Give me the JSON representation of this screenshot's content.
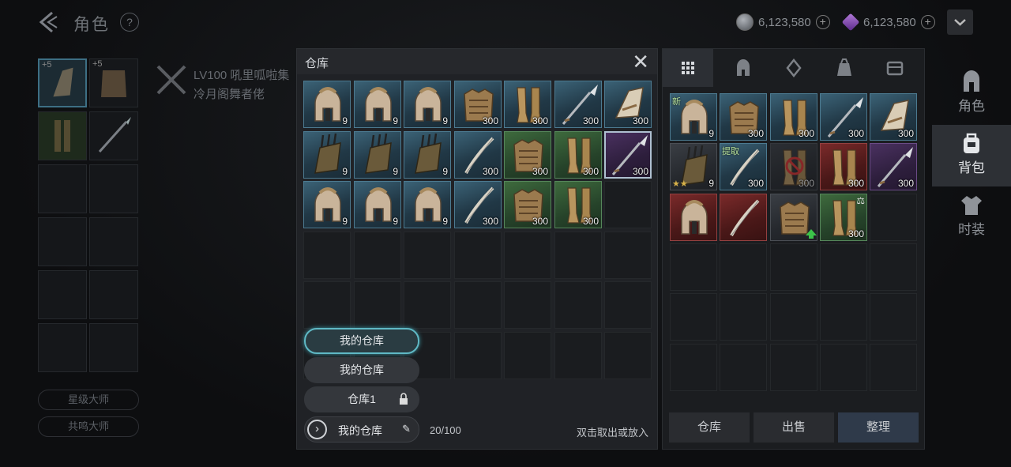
{
  "header": {
    "back_icon": "back-chevron-icon",
    "title": "角色",
    "help": "?",
    "currency": [
      {
        "icon": "silver-coin-icon",
        "amount": "6,123,580"
      },
      {
        "icon": "purple-gem-icon",
        "amount": "6,123,580"
      }
    ],
    "dropdown_icon": "chevron-down-icon"
  },
  "character": {
    "level_line": "LV100  吼里呱啦集",
    "title": "冷月阁舞者佬",
    "equip_plus": [
      "+5",
      "+5"
    ],
    "buttons": [
      "星级大师",
      "共鸣大师"
    ]
  },
  "warehouse": {
    "title": "仓库",
    "close": "✕",
    "items": [
      {
        "type": "helmet",
        "rarity": "blue",
        "qty": "9"
      },
      {
        "type": "helmet",
        "rarity": "blue",
        "qty": "9"
      },
      {
        "type": "helmet",
        "rarity": "blue",
        "qty": "9"
      },
      {
        "type": "armor",
        "rarity": "blue",
        "qty": "300"
      },
      {
        "type": "greaves",
        "rarity": "blue",
        "qty": "300"
      },
      {
        "type": "spear",
        "rarity": "blue",
        "qty": "300"
      },
      {
        "type": "bracer",
        "rarity": "blue",
        "qty": "300"
      },
      {
        "type": "quiver",
        "rarity": "blue",
        "qty": "9"
      },
      {
        "type": "quiver",
        "rarity": "blue",
        "qty": "9"
      },
      {
        "type": "quiver",
        "rarity": "blue",
        "qty": "9"
      },
      {
        "type": "bow",
        "rarity": "blue",
        "qty": "300"
      },
      {
        "type": "armor",
        "rarity": "green",
        "qty": "300"
      },
      {
        "type": "greaves",
        "rarity": "green",
        "qty": "300"
      },
      {
        "type": "spear",
        "rarity": "purple",
        "qty": "300",
        "selected": true
      },
      {
        "type": "helmet",
        "rarity": "blue",
        "qty": "9"
      },
      {
        "type": "helmet",
        "rarity": "blue",
        "qty": "9"
      },
      {
        "type": "helmet",
        "rarity": "blue",
        "qty": "9"
      },
      {
        "type": "bow",
        "rarity": "blue",
        "qty": "300"
      },
      {
        "type": "armor",
        "rarity": "green",
        "qty": "300"
      },
      {
        "type": "greaves",
        "rarity": "green",
        "qty": "300"
      }
    ],
    "options": [
      "我的仓库",
      "我的仓库",
      "仓库1"
    ],
    "current": "我的仓库",
    "capacity": "20/100",
    "hint": "双击取出或放入"
  },
  "inventory": {
    "tabs": [
      "grid-icon",
      "helmet-icon",
      "gem-icon",
      "bag-icon",
      "chest-icon"
    ],
    "items": [
      {
        "type": "helmet",
        "rarity": "blue",
        "qty": "9",
        "tag": "新"
      },
      {
        "type": "armor",
        "rarity": "blue",
        "qty": "300"
      },
      {
        "type": "greaves",
        "rarity": "blue",
        "qty": "300"
      },
      {
        "type": "spear",
        "rarity": "blue",
        "qty": "300"
      },
      {
        "type": "bracer",
        "rarity": "blue",
        "qty": "300"
      },
      {
        "type": "quiver",
        "rarity": "dim",
        "qty": "9",
        "stars": true
      },
      {
        "type": "bow",
        "rarity": "blue",
        "qty": "300",
        "tag": "提取"
      },
      {
        "type": "greaves",
        "rarity": "dim",
        "qty": "300",
        "banned": true
      },
      {
        "type": "greaves",
        "rarity": "red",
        "qty": "300"
      },
      {
        "type": "spear",
        "rarity": "purple",
        "qty": "300"
      },
      {
        "type": "helmet",
        "rarity": "red",
        "qty": ""
      },
      {
        "type": "bow",
        "rarity": "red",
        "qty": ""
      },
      {
        "type": "armor",
        "rarity": "dim",
        "qty": "",
        "up": true
      },
      {
        "type": "greaves",
        "rarity": "green",
        "qty": "300",
        "scale": true
      }
    ],
    "buttons": [
      "仓库",
      "出售",
      "整理"
    ]
  },
  "nav": [
    {
      "icon": "helmet-icon",
      "label": "角色"
    },
    {
      "icon": "backpack-icon",
      "label": "背包",
      "active": true
    },
    {
      "icon": "fashion-icon",
      "label": "时装"
    }
  ],
  "colors": {
    "blue_rarity": "#3b6276",
    "green_rarity": "#3e6a3d",
    "purple_rarity": "#4a3160",
    "red_rarity": "#7a2a2a",
    "accent_cyan": "#5fb8c4"
  }
}
